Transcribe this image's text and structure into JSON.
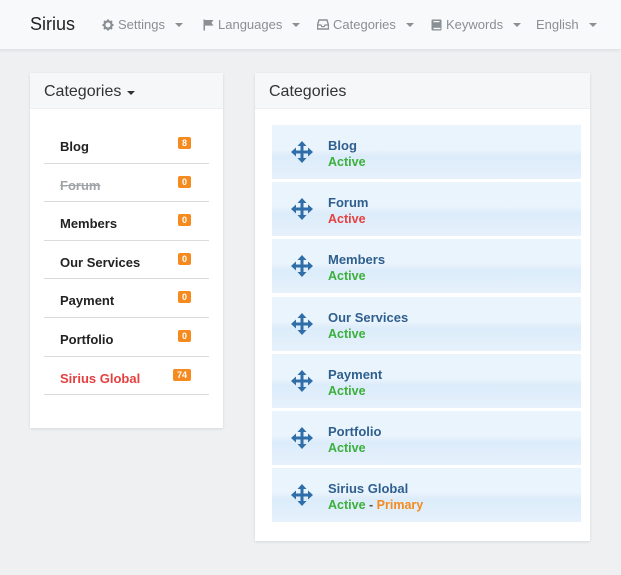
{
  "navbar": {
    "brand": "Sirius",
    "items": [
      {
        "label": "Settings",
        "icon": "gear-icon"
      },
      {
        "label": "Languages",
        "icon": "flag-icon"
      },
      {
        "label": "Categories",
        "icon": "inbox-icon"
      },
      {
        "label": "Keywords",
        "icon": "book-icon"
      },
      {
        "label": "English",
        "icon": ""
      }
    ]
  },
  "left_panel": {
    "title": "Categories",
    "items": [
      {
        "label": "Blog",
        "count": "8",
        "state": "normal"
      },
      {
        "label": "Forum",
        "count": "0",
        "state": "strikethrough"
      },
      {
        "label": "Members",
        "count": "0",
        "state": "normal"
      },
      {
        "label": "Our Services",
        "count": "0",
        "state": "normal"
      },
      {
        "label": "Payment",
        "count": "0",
        "state": "normal"
      },
      {
        "label": "Portfolio",
        "count": "0",
        "state": "normal"
      },
      {
        "label": "Sirius Global",
        "count": "74",
        "state": "highlight"
      }
    ]
  },
  "right_panel": {
    "title": "Categories",
    "items": [
      {
        "label": "Blog",
        "status": "Active",
        "primary": ""
      },
      {
        "label": "Forum",
        "status": "Active",
        "primary": ""
      },
      {
        "label": "Members",
        "status": "Active",
        "primary": ""
      },
      {
        "label": "Our Services",
        "status": "Active",
        "primary": ""
      },
      {
        "label": "Payment",
        "status": "Active",
        "primary": ""
      },
      {
        "label": "Portfolio",
        "status": "Active",
        "primary": ""
      },
      {
        "label": "Sirius Global",
        "status": "Active",
        "primary": "Primary"
      }
    ],
    "separator": "-"
  },
  "colors": {
    "badge": "#f58a1f",
    "active_green": "#3bb03b",
    "inactive_red": "#e64040",
    "primary_orange": "#f58a1f",
    "title_blue": "#2f5f8f",
    "move_icon_blue": "#2f6ea8"
  }
}
